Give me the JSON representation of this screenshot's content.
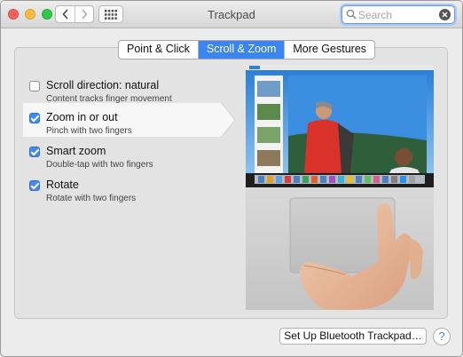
{
  "window": {
    "title": "Trackpad"
  },
  "search": {
    "placeholder": "Search",
    "value": ""
  },
  "tabs": [
    {
      "label": "Point & Click",
      "active": false
    },
    {
      "label": "Scroll & Zoom",
      "active": true
    },
    {
      "label": "More Gestures",
      "active": false
    }
  ],
  "options": [
    {
      "title": "Scroll direction: natural",
      "description": "Content tracks finger movement",
      "checked": false
    },
    {
      "title": "Zoom in or out",
      "description": "Pinch with two fingers",
      "checked": true,
      "selected": true
    },
    {
      "title": "Smart zoom",
      "description": "Double-tap with two fingers",
      "checked": true
    },
    {
      "title": "Rotate",
      "description": "Rotate with two fingers",
      "checked": true
    }
  ],
  "buttons": {
    "setup_bluetooth": "Set Up Bluetooth Trackpad…",
    "help": "?"
  },
  "colors": {
    "accent": "#3b85f0",
    "close": "#fc605c",
    "minimize": "#fdbc40",
    "maximize": "#34c84a"
  }
}
